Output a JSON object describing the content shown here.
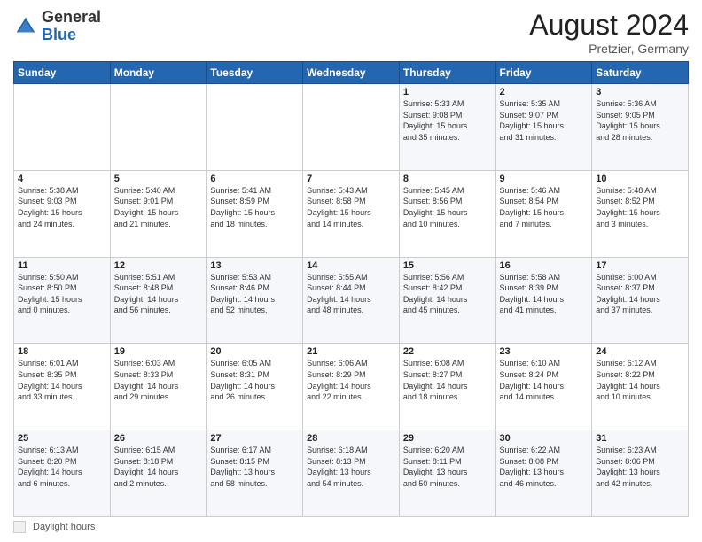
{
  "header": {
    "logo_general": "General",
    "logo_blue": "Blue",
    "month_title": "August 2024",
    "location": "Pretzier, Germany"
  },
  "footer": {
    "daylight_label": "Daylight hours"
  },
  "weekdays": [
    "Sunday",
    "Monday",
    "Tuesday",
    "Wednesday",
    "Thursday",
    "Friday",
    "Saturday"
  ],
  "weeks": [
    [
      {
        "day": "",
        "info": ""
      },
      {
        "day": "",
        "info": ""
      },
      {
        "day": "",
        "info": ""
      },
      {
        "day": "",
        "info": ""
      },
      {
        "day": "1",
        "info": "Sunrise: 5:33 AM\nSunset: 9:08 PM\nDaylight: 15 hours\nand 35 minutes."
      },
      {
        "day": "2",
        "info": "Sunrise: 5:35 AM\nSunset: 9:07 PM\nDaylight: 15 hours\nand 31 minutes."
      },
      {
        "day": "3",
        "info": "Sunrise: 5:36 AM\nSunset: 9:05 PM\nDaylight: 15 hours\nand 28 minutes."
      }
    ],
    [
      {
        "day": "4",
        "info": "Sunrise: 5:38 AM\nSunset: 9:03 PM\nDaylight: 15 hours\nand 24 minutes."
      },
      {
        "day": "5",
        "info": "Sunrise: 5:40 AM\nSunset: 9:01 PM\nDaylight: 15 hours\nand 21 minutes."
      },
      {
        "day": "6",
        "info": "Sunrise: 5:41 AM\nSunset: 8:59 PM\nDaylight: 15 hours\nand 18 minutes."
      },
      {
        "day": "7",
        "info": "Sunrise: 5:43 AM\nSunset: 8:58 PM\nDaylight: 15 hours\nand 14 minutes."
      },
      {
        "day": "8",
        "info": "Sunrise: 5:45 AM\nSunset: 8:56 PM\nDaylight: 15 hours\nand 10 minutes."
      },
      {
        "day": "9",
        "info": "Sunrise: 5:46 AM\nSunset: 8:54 PM\nDaylight: 15 hours\nand 7 minutes."
      },
      {
        "day": "10",
        "info": "Sunrise: 5:48 AM\nSunset: 8:52 PM\nDaylight: 15 hours\nand 3 minutes."
      }
    ],
    [
      {
        "day": "11",
        "info": "Sunrise: 5:50 AM\nSunset: 8:50 PM\nDaylight: 15 hours\nand 0 minutes."
      },
      {
        "day": "12",
        "info": "Sunrise: 5:51 AM\nSunset: 8:48 PM\nDaylight: 14 hours\nand 56 minutes."
      },
      {
        "day": "13",
        "info": "Sunrise: 5:53 AM\nSunset: 8:46 PM\nDaylight: 14 hours\nand 52 minutes."
      },
      {
        "day": "14",
        "info": "Sunrise: 5:55 AM\nSunset: 8:44 PM\nDaylight: 14 hours\nand 48 minutes."
      },
      {
        "day": "15",
        "info": "Sunrise: 5:56 AM\nSunset: 8:42 PM\nDaylight: 14 hours\nand 45 minutes."
      },
      {
        "day": "16",
        "info": "Sunrise: 5:58 AM\nSunset: 8:39 PM\nDaylight: 14 hours\nand 41 minutes."
      },
      {
        "day": "17",
        "info": "Sunrise: 6:00 AM\nSunset: 8:37 PM\nDaylight: 14 hours\nand 37 minutes."
      }
    ],
    [
      {
        "day": "18",
        "info": "Sunrise: 6:01 AM\nSunset: 8:35 PM\nDaylight: 14 hours\nand 33 minutes."
      },
      {
        "day": "19",
        "info": "Sunrise: 6:03 AM\nSunset: 8:33 PM\nDaylight: 14 hours\nand 29 minutes."
      },
      {
        "day": "20",
        "info": "Sunrise: 6:05 AM\nSunset: 8:31 PM\nDaylight: 14 hours\nand 26 minutes."
      },
      {
        "day": "21",
        "info": "Sunrise: 6:06 AM\nSunset: 8:29 PM\nDaylight: 14 hours\nand 22 minutes."
      },
      {
        "day": "22",
        "info": "Sunrise: 6:08 AM\nSunset: 8:27 PM\nDaylight: 14 hours\nand 18 minutes."
      },
      {
        "day": "23",
        "info": "Sunrise: 6:10 AM\nSunset: 8:24 PM\nDaylight: 14 hours\nand 14 minutes."
      },
      {
        "day": "24",
        "info": "Sunrise: 6:12 AM\nSunset: 8:22 PM\nDaylight: 14 hours\nand 10 minutes."
      }
    ],
    [
      {
        "day": "25",
        "info": "Sunrise: 6:13 AM\nSunset: 8:20 PM\nDaylight: 14 hours\nand 6 minutes."
      },
      {
        "day": "26",
        "info": "Sunrise: 6:15 AM\nSunset: 8:18 PM\nDaylight: 14 hours\nand 2 minutes."
      },
      {
        "day": "27",
        "info": "Sunrise: 6:17 AM\nSunset: 8:15 PM\nDaylight: 13 hours\nand 58 minutes."
      },
      {
        "day": "28",
        "info": "Sunrise: 6:18 AM\nSunset: 8:13 PM\nDaylight: 13 hours\nand 54 minutes."
      },
      {
        "day": "29",
        "info": "Sunrise: 6:20 AM\nSunset: 8:11 PM\nDaylight: 13 hours\nand 50 minutes."
      },
      {
        "day": "30",
        "info": "Sunrise: 6:22 AM\nSunset: 8:08 PM\nDaylight: 13 hours\nand 46 minutes."
      },
      {
        "day": "31",
        "info": "Sunrise: 6:23 AM\nSunset: 8:06 PM\nDaylight: 13 hours\nand 42 minutes."
      }
    ]
  ]
}
